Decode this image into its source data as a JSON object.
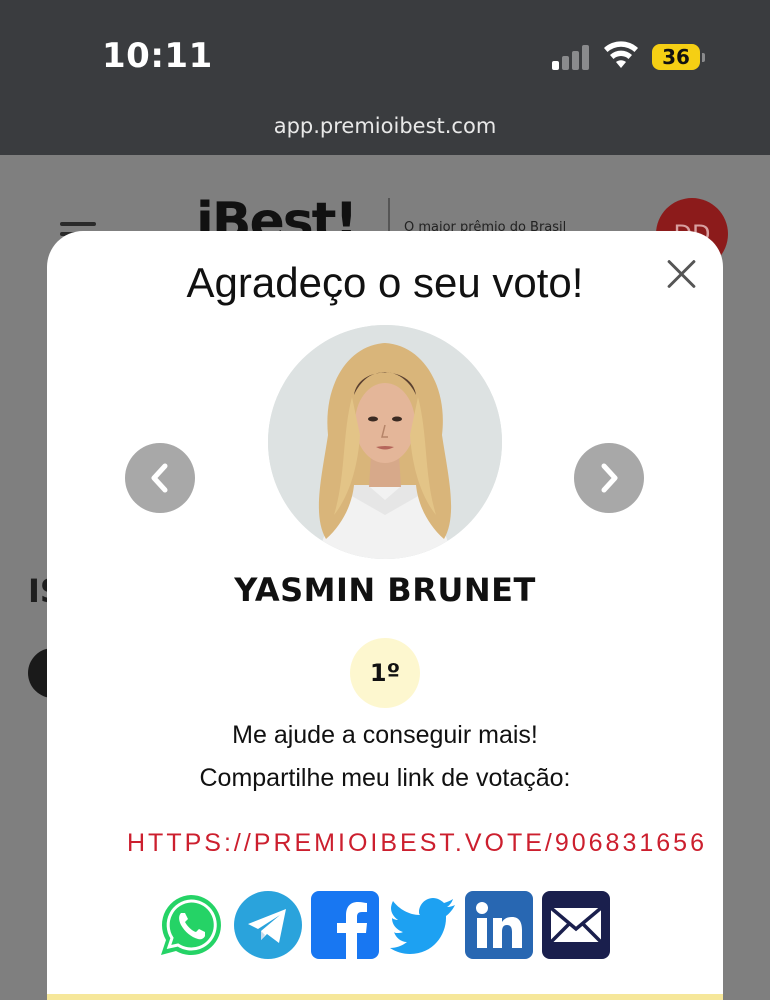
{
  "status_bar": {
    "time": "10:11",
    "battery": "36"
  },
  "browser": {
    "url": "app.premioibest.com"
  },
  "background_page": {
    "logo": "iBest!",
    "tagline": "O maior prêmio do Brasil",
    "avatar_initials": "DD",
    "partial_text": "IS"
  },
  "modal": {
    "title": "Agradeço o seu voto!",
    "candidate_name": "YASMIN BRUNET",
    "rank": "1º",
    "message_line1": "Me ajude a conseguir mais!",
    "message_line2": "Compartilhe meu link de votação:",
    "vote_link": "HTTPS://PREMIOIBEST.VOTE/906831656"
  },
  "share_icons": [
    "whatsapp-icon",
    "telegram-icon",
    "facebook-icon",
    "twitter-icon",
    "linkedin-icon",
    "email-icon"
  ],
  "colors": {
    "link": "#cc1f2e",
    "rank_badge": "#fdf7cf",
    "whatsapp": "#25d366",
    "telegram": "#2aa3dc",
    "facebook": "#1877f2",
    "twitter": "#1da1f2",
    "linkedin": "#2867b2",
    "email": "#1a1f4d"
  }
}
